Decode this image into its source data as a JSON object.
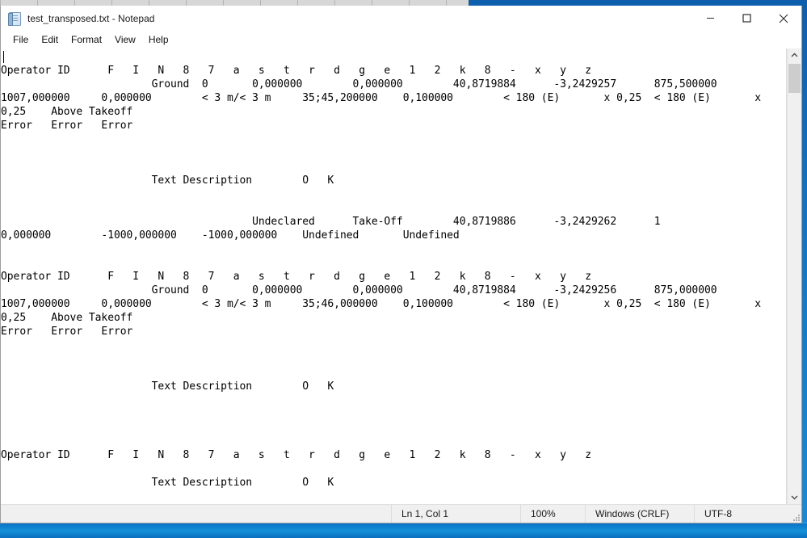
{
  "window": {
    "title": "test_transposed.txt - Notepad",
    "icon": "notepad-icon",
    "minimize_label": "Minimize",
    "maximize_label": "Maximize",
    "close_label": "Close"
  },
  "menubar": {
    "items": [
      {
        "label": "File"
      },
      {
        "label": "Edit"
      },
      {
        "label": "Format"
      },
      {
        "label": "View"
      },
      {
        "label": "Help"
      }
    ]
  },
  "editor": {
    "caret_visible": true,
    "lines": [
      "",
      "Operator ID      F   I   N   8   7   a   s   t   r   d   g   e   1   2   k   8   -   x   y   z",
      "                        Ground  0       0,000000        0,000000        40,8719884      -3,2429257      875,500000",
      "1007,000000     0,000000        < 3 m/< 3 m     35;45,200000    0,100000        < 180 (E)       x 0,25  < 180 (E)       x",
      "0,25    Above Takeoff",
      "Error   Error   Error",
      "",
      "",
      "",
      "                        Text Description        O   K",
      "",
      "",
      "                                        Undeclared      Take-Off        40,8719886      -3,2429262      1",
      "0,000000        -1000,000000    -1000,000000    Undefined       Undefined",
      "",
      "",
      "Operator ID      F   I   N   8   7   a   s   t   r   d   g   e   1   2   k   8   -   x   y   z",
      "                        Ground  0       0,000000        0,000000        40,8719884      -3,2429256      875,000000",
      "1007,000000     0,000000        < 3 m/< 3 m     35;46,000000    0,100000        < 180 (E)       x 0,25  < 180 (E)       x",
      "0,25    Above Takeoff",
      "Error   Error   Error",
      "",
      "",
      "",
      "                        Text Description        O   K",
      "",
      "",
      "",
      "",
      "Operator ID      F   I   N   8   7   a   s   t   r   d   g   e   1   2   k   8   -   x   y   z",
      "",
      "                        Text Description        O   K"
    ]
  },
  "scrollbar": {
    "up_icon": "chevron-up-icon",
    "down_icon": "chevron-down-icon",
    "thumb": "scroll-thumb"
  },
  "statusbar": {
    "position": "Ln 1, Col 1",
    "zoom": "100%",
    "line_endings": "Windows (CRLF)",
    "encoding": "UTF-8"
  },
  "colors": {
    "desktop": "#1173c4",
    "window_bg": "#ffffff",
    "text": "#000000",
    "statusbar_bg": "#f0f0f0",
    "scroll_thumb": "#cdcdcd"
  }
}
